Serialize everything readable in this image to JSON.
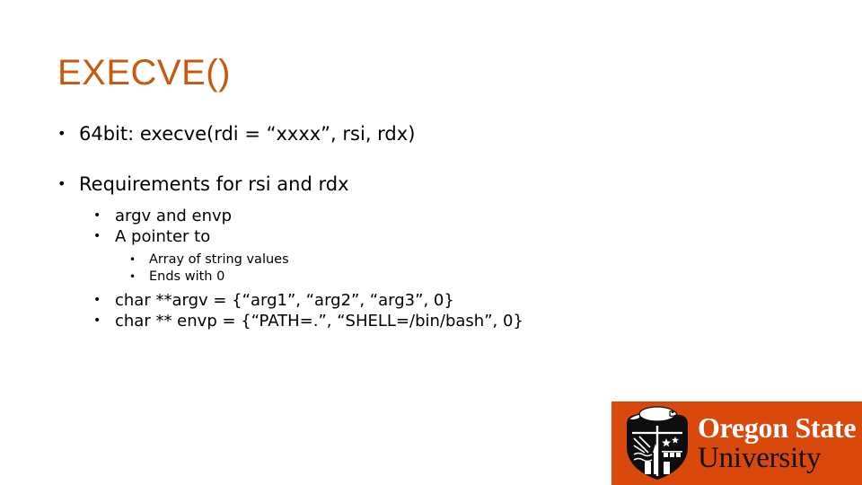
{
  "slide": {
    "title": "EXECVE()",
    "title_color": "#C55A11",
    "background_color": "#FFFFFF",
    "body_color": "#000000",
    "bullets": [
      {
        "level": 1,
        "marker": "•",
        "text": "64bit: execve(rdi = “xxxx”, rsi, rdx)"
      },
      {
        "level": 1,
        "marker": "•",
        "text": "Requirements for rsi and rdx"
      },
      {
        "level": 2,
        "marker": "•",
        "text": "argv and envp"
      },
      {
        "level": 2,
        "marker": "•",
        "text": "A pointer to"
      },
      {
        "level": 3,
        "marker": "•",
        "text": "Array of string values"
      },
      {
        "level": 3,
        "marker": "•",
        "text": "Ends with 0"
      },
      {
        "level": 2,
        "marker": "•",
        "text": "char **argv = {“arg1”, “arg2”, “arg3”, 0}"
      },
      {
        "level": 2,
        "marker": "•",
        "text": "char ** envp = {“PATH=.”, “SHELL=/bin/bash”, 0}"
      }
    ]
  },
  "logo": {
    "name": "oregon-state-university-logo",
    "background_color": "#D8490B",
    "line1": "Oregon State",
    "line1_color": "#FFFFFF",
    "line2": "University",
    "line2_color": "#111111",
    "crest_alt": "beaver-crest-shield"
  }
}
